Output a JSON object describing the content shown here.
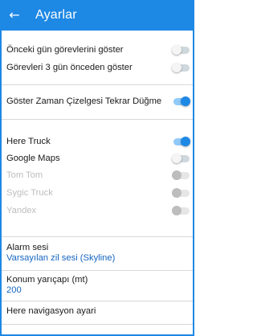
{
  "appbar": {
    "back_icon": "arrow-left-icon",
    "title": "Ayarlar",
    "color": "#1e88e5"
  },
  "toggles": [
    {
      "label": "Önceki gün görevlerini göster",
      "state": "off",
      "enabled": true
    },
    {
      "label": "Görevleri 3 gün önceden göster",
      "state": "off",
      "enabled": true
    },
    {
      "label": "Göster Zaman Çizelgesi Tekrar Düğme",
      "state": "on",
      "enabled": true
    },
    {
      "label": "Here Truck",
      "state": "on",
      "enabled": true
    },
    {
      "label": "Google Maps",
      "state": "off",
      "enabled": true
    },
    {
      "label": "Tom Tom",
      "state": "off",
      "enabled": false
    },
    {
      "label": "Sygic Truck",
      "state": "off",
      "enabled": false
    },
    {
      "label": "Yandex",
      "state": "off",
      "enabled": false
    }
  ],
  "alarm": {
    "title": "Alarm sesi",
    "value": "Varsayılan zil sesi (Skyline)"
  },
  "radius": {
    "title": "Konum yarıçapı (mt)",
    "value": "200"
  },
  "navigation": {
    "title": "Here navigasyon ayari"
  }
}
